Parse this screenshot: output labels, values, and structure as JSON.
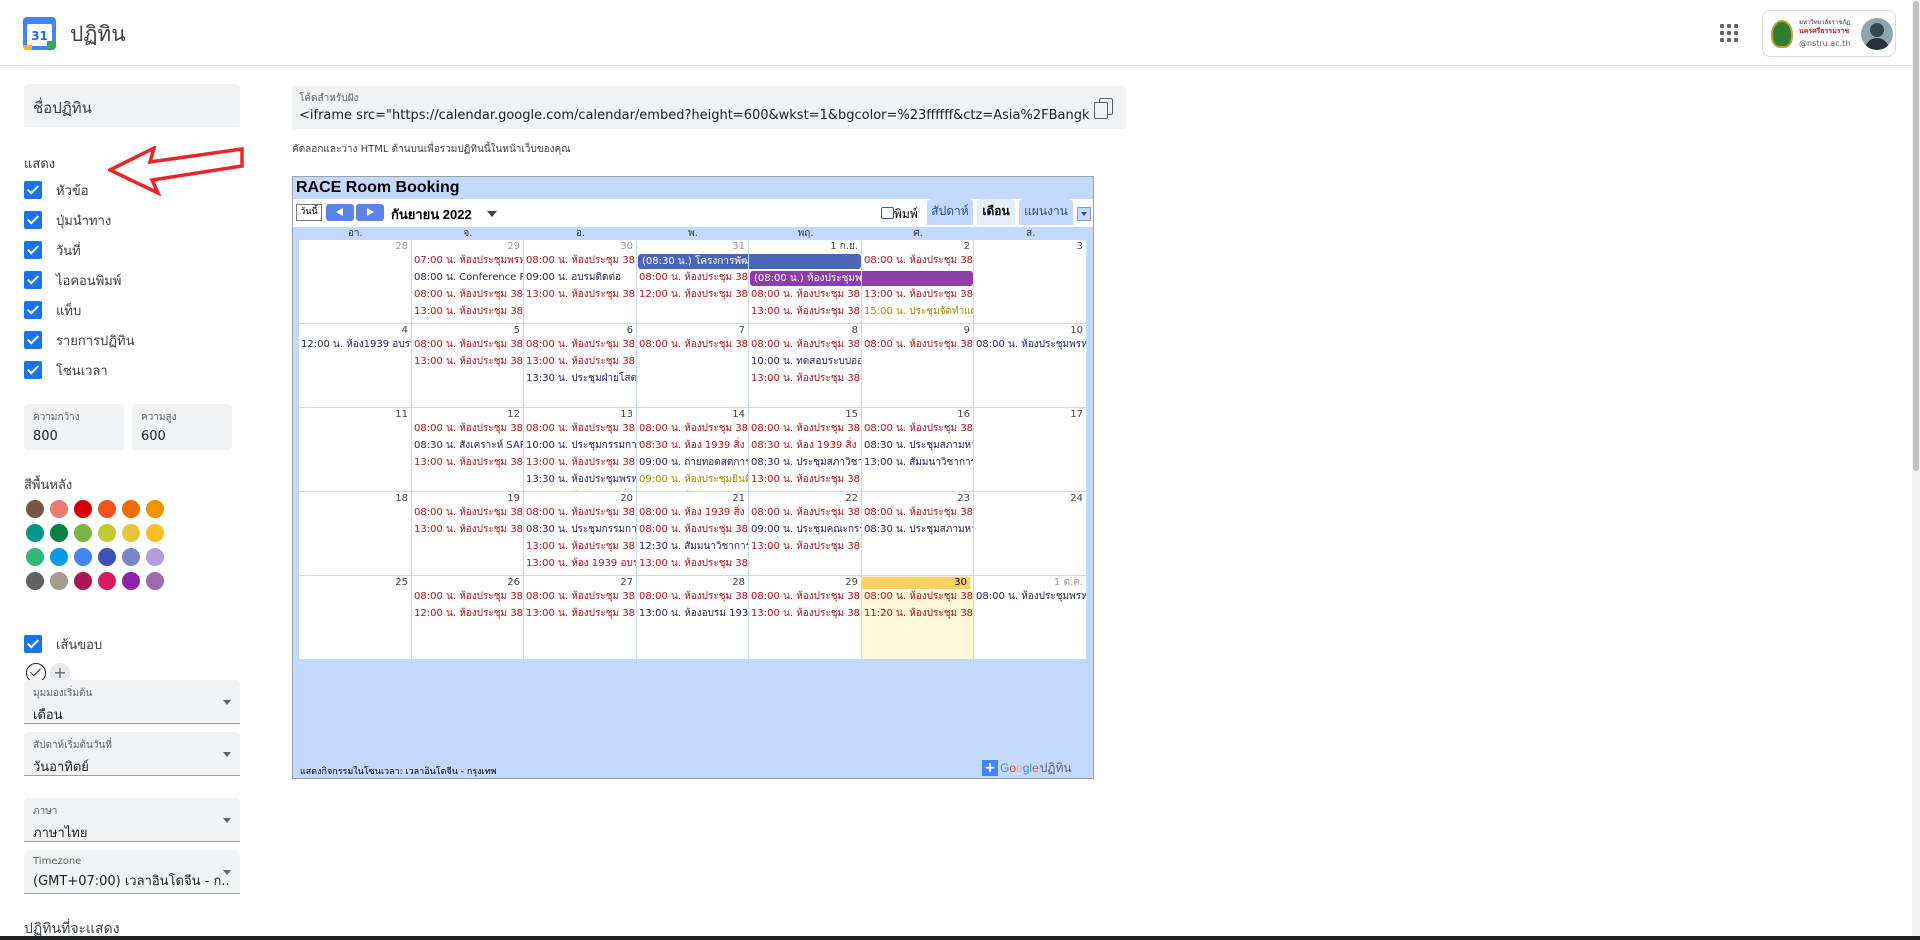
{
  "header": {
    "logo_number": "31",
    "app_title": "ปฏิทิน",
    "account_org_line1": "มหาวิทยาลัยราชภัฏ",
    "account_org_line2": "นครศรีธรรมราช",
    "account_domain": "@nstru.ac.th"
  },
  "sidebar": {
    "calendar_name": "ชื่อปฏิทิน",
    "show_label": "แสดง",
    "show_options": [
      {
        "label": "หัวข้อ",
        "checked": true
      },
      {
        "label": "ปุ่มนำทาง",
        "checked": true
      },
      {
        "label": "วันที่",
        "checked": true
      },
      {
        "label": "ไอคอนพิมพ์",
        "checked": true
      },
      {
        "label": "แท็บ",
        "checked": true
      },
      {
        "label": "รายการปฏิทิน",
        "checked": true
      },
      {
        "label": "โซนเวลา",
        "checked": true
      }
    ],
    "width_label": "ความกว้าง",
    "width_value": "800",
    "height_label": "ความสูง",
    "height_value": "600",
    "bg_label": "สีพื้นหลัง",
    "swatches": [
      "#795548",
      "#e67c73",
      "#d50000",
      "#f4511e",
      "#ef6c00",
      "#f09300",
      "#009688",
      "#0b8043",
      "#7cb342",
      "#c0ca33",
      "#e4c441",
      "#f6bf26",
      "#33b679",
      "#039be5",
      "#4285f4",
      "#3f51b5",
      "#7986cb",
      "#b39ddb",
      "#616161",
      "#a79b8e",
      "#ad1457",
      "#d81b60",
      "#8e24aa",
      "#9e69af"
    ],
    "border_label": "เส้นขอบ",
    "border_checked": true,
    "default_view_label": "มุมมองเริ่มต้น",
    "default_view_value": "เดือน",
    "week_start_label": "สัปดาห์เริ่มต้นวันที่",
    "week_start_value": "วันอาทิตย์",
    "language_label": "ภาษา",
    "language_value": "ภาษาไทย",
    "timezone_label": "Timezone",
    "timezone_value": "(GMT+07:00) เวลาอินโดจีน - ก...",
    "calendars_label": "ปฏิทินที่จะแสดง"
  },
  "embed": {
    "label": "โค้ดสำหรับฝัง",
    "code": "<iframe src=\"https://calendar.google.com/calendar/embed?height=600&wkst=1&bgcolor=%23ffffff&ctz=Asia%2FBangkok&src",
    "hint": "คัดลอกและวาง HTML ด้านบนเพื่อรวมปฏิทินนี้ในหน้าเว็บของคุณ"
  },
  "calendar": {
    "title": "RACE Room Booking",
    "today_label": "วันนี้",
    "month_label": "กันยายน 2022",
    "print_label": "พิมพ์",
    "tabs": [
      {
        "label": "สัปดาห์",
        "active": false
      },
      {
        "label": "เดือน",
        "active": true
      },
      {
        "label": "แผนงาน",
        "active": false
      }
    ],
    "dow": [
      "อา.",
      "จ.",
      "อ.",
      "พ.",
      "พฤ.",
      "ศ.",
      "ส."
    ],
    "timezone_note": "แสดงกิจกรรมในโซนเวลา: เวลาอินโดจีน - กรุงเทพ",
    "google_word": [
      "G",
      "o",
      "o",
      "g",
      "l",
      "e"
    ],
    "google_suffix": "ปฏิทิน",
    "colors": {
      "red": "#b31412",
      "navy": "#222266",
      "olive": "#a28a00",
      "allday_blue": "#4a66b8",
      "allday_purple": "#8e3ea8",
      "today_bg": "#fff7d7"
    },
    "weeks": [
      [
        {
          "day": "28",
          "other": true,
          "events": []
        },
        {
          "day": "29",
          "other": true,
          "events": [
            {
              "text": "07:00 น. ห้องประชุมพรหม",
              "color": "red"
            },
            {
              "text": "08:00 น. Conference Ro",
              "color": "navy"
            },
            {
              "text": "08:00 น. ห้องประชุม 38",
              "color": "red"
            },
            {
              "text": "13:00 น. ห้องประชุม 38",
              "color": "red"
            }
          ]
        },
        {
          "day": "30",
          "other": true,
          "events": [
            {
              "text": "08:00 น. ห้องประชุม 38",
              "color": "red"
            },
            {
              "text": "09:00 น. อบรมติดต่อ",
              "color": "navy"
            },
            {
              "text": "13:00 น. ห้องประชุม 38",
              "color": "red"
            }
          ]
        },
        {
          "day": "31",
          "other": true,
          "events": [
            {
              "text": "(08:30 น.) โครงการพัฒนาบุคลากรสายสนับสนุน",
              "color": "allday_blue",
              "allday": true
            },
            {
              "text": "08:00 น. ห้องประชุม 38",
              "color": "red"
            },
            {
              "text": "12:00 น. ห้องประชุม 38",
              "color": "red"
            }
          ]
        },
        {
          "day": "1 ก.ย.",
          "events": [
            {
              "text": "",
              "color": "allday_blue",
              "allday": true,
              "cont": true
            },
            {
              "text": "(08:00 น.) ห้องประชุมพรหมโยธี โครงการสร้าง",
              "color": "allday_purple",
              "allday": true
            },
            {
              "text": "08:00 น. ห้องประชุม 38",
              "color": "red"
            },
            {
              "text": "13:00 น. ห้องประชุม 38",
              "color": "red"
            }
          ]
        },
        {
          "day": "2",
          "events": [
            {
              "text": "08:00 น. ห้องประชุม 38",
              "color": "red"
            },
            {
              "text": "",
              "color": "allday_purple",
              "allday": true,
              "cont": true
            },
            {
              "text": "13:00 น. ห้องประชุม 38",
              "color": "red"
            },
            {
              "text": "15:00 น. ประชุมจัดทำแผน",
              "color": "olive"
            }
          ]
        },
        {
          "day": "3",
          "events": []
        }
      ],
      [
        {
          "day": "4",
          "events": [
            {
              "text": "12:00 น. ห้อง1939 อบรม",
              "color": "navy"
            }
          ]
        },
        {
          "day": "5",
          "events": [
            {
              "text": "08:00 น. ห้องประชุม 38",
              "color": "red"
            },
            {
              "text": "13:00 น. ห้องประชุม 38",
              "color": "red"
            }
          ]
        },
        {
          "day": "6",
          "events": [
            {
              "text": "08:00 น. ห้องประชุม 38",
              "color": "red"
            },
            {
              "text": "13:00 น. ห้องประชุม 38",
              "color": "red"
            },
            {
              "text": "13:30 น. ประชุมฝ่ายโสตฯ",
              "color": "navy"
            }
          ]
        },
        {
          "day": "7",
          "events": [
            {
              "text": "08:00 น. ห้องประชุม 38",
              "color": "red"
            }
          ]
        },
        {
          "day": "8",
          "events": [
            {
              "text": "08:00 น. ห้องประชุม 38",
              "color": "red"
            },
            {
              "text": "10:00 น. ทดสอบระบบออ",
              "color": "navy"
            },
            {
              "text": "13:00 น. ห้องประชุม 38",
              "color": "red"
            }
          ]
        },
        {
          "day": "9",
          "events": [
            {
              "text": "08:00 น. ห้องประชุม 38",
              "color": "red"
            }
          ]
        },
        {
          "day": "10",
          "events": [
            {
              "text": "08:00 น. ห้องประชุมพรหม",
              "color": "navy"
            }
          ]
        }
      ],
      [
        {
          "day": "11",
          "events": []
        },
        {
          "day": "12",
          "events": [
            {
              "text": "08:00 น. ห้องประชุม 38",
              "color": "red"
            },
            {
              "text": "08:30 น. สังเคราะห์ SAR",
              "color": "navy"
            },
            {
              "text": "13:00 น. ห้องประชุม 38",
              "color": "red"
            }
          ]
        },
        {
          "day": "13",
          "events": [
            {
              "text": "08:00 น. ห้องประชุม 38",
              "color": "red"
            },
            {
              "text": "10:00 น. ประชุมกรรมการ",
              "color": "navy"
            },
            {
              "text": "13:00 น. ห้องประชุม 38",
              "color": "red"
            },
            {
              "text": "13:30 น. ห้องประชุมพรหม",
              "color": "navy"
            },
            {
              "text": "14:00 น. ห้อง 1939 สิ่ง",
              "color": "red"
            }
          ]
        },
        {
          "day": "14",
          "events": [
            {
              "text": "08:00 น. ห้องประชุม 38",
              "color": "red"
            },
            {
              "text": "08:30 น. ห้อง 1939 สิ่ง",
              "color": "red"
            },
            {
              "text": "09:00 น. ถ่ายทอดสดการ",
              "color": "navy"
            },
            {
              "text": "09:00 น. ห้องประชุมยินดี",
              "color": "olive"
            },
            {
              "text": "13:00 น. ห้องประชุม 38",
              "color": "red"
            }
          ]
        },
        {
          "day": "15",
          "events": [
            {
              "text": "08:00 น. ห้องประชุม 38",
              "color": "red"
            },
            {
              "text": "08:30 น. ห้อง 1939 สิ่ง",
              "color": "red"
            },
            {
              "text": "08:30 น. ประชุมสภาวิชา",
              "color": "navy"
            },
            {
              "text": "13:00 น. ห้องประชุม 38",
              "color": "red"
            }
          ]
        },
        {
          "day": "16",
          "events": [
            {
              "text": "08:00 น. ห้องประชุม 38",
              "color": "red"
            },
            {
              "text": "08:30 น. ประชุมสภามหา",
              "color": "navy"
            },
            {
              "text": "13:00 น. สัมมนาวิชาการ",
              "color": "navy"
            }
          ]
        },
        {
          "day": "17",
          "events": []
        }
      ],
      [
        {
          "day": "18",
          "events": []
        },
        {
          "day": "19",
          "events": [
            {
              "text": "08:00 น. ห้องประชุม 38",
              "color": "red"
            },
            {
              "text": "13:00 น. ห้องประชุม 38",
              "color": "red"
            }
          ]
        },
        {
          "day": "20",
          "events": [
            {
              "text": "08:00 น. ห้องประชุม 38",
              "color": "red"
            },
            {
              "text": "08:30 น. ประชุมกรรมการ",
              "color": "navy"
            },
            {
              "text": "13:00 น. ห้องประชุม 38",
              "color": "red"
            },
            {
              "text": "13:00 น. ห้อง 1939 อบรม",
              "color": "red"
            }
          ]
        },
        {
          "day": "21",
          "events": [
            {
              "text": "08:00 น. ห้อง 1939 สิ่ง",
              "color": "red"
            },
            {
              "text": "08:00 น. ห้องประชุม 38",
              "color": "red"
            },
            {
              "text": "12:30 น. สัมมนาวิชาการ",
              "color": "navy"
            },
            {
              "text": "13:00 น. ห้องประชุม 38",
              "color": "red"
            }
          ]
        },
        {
          "day": "22",
          "events": [
            {
              "text": "08:00 น. ห้องประชุม 38",
              "color": "red"
            },
            {
              "text": "09:00 น. ประชุมคณะกรรม",
              "color": "navy"
            },
            {
              "text": "13:00 น. ห้องประชุม 38",
              "color": "red"
            }
          ]
        },
        {
          "day": "23",
          "events": [
            {
              "text": "08:00 น. ห้องประชุม 38",
              "color": "red"
            },
            {
              "text": "08:30 น. ประชุมสภามหา",
              "color": "navy"
            }
          ]
        },
        {
          "day": "24",
          "events": []
        }
      ],
      [
        {
          "day": "25",
          "events": []
        },
        {
          "day": "26",
          "events": [
            {
              "text": "08:00 น. ห้องประชุม 38",
              "color": "red"
            },
            {
              "text": "12:00 น. ห้องประชุม 38",
              "color": "red"
            }
          ]
        },
        {
          "day": "27",
          "events": [
            {
              "text": "08:00 น. ห้องประชุม 38",
              "color": "red"
            },
            {
              "text": "13:00 น. ห้องประชุม 38",
              "color": "red"
            }
          ]
        },
        {
          "day": "28",
          "events": [
            {
              "text": "08:00 น. ห้องประชุม 38",
              "color": "red"
            },
            {
              "text": "13:00 น. ห้องอบรม 1939",
              "color": "navy"
            }
          ]
        },
        {
          "day": "29",
          "events": [
            {
              "text": "08:00 น. ห้องประชุม 38",
              "color": "red"
            },
            {
              "text": "13:00 น. ห้องประชุม 38",
              "color": "red"
            }
          ]
        },
        {
          "day": "30",
          "today": true,
          "events": [
            {
              "text": "08:00 น. ห้องประชุม 38",
              "color": "red"
            },
            {
              "text": "11:20 น. ห้องประชุม 38",
              "color": "red"
            }
          ]
        },
        {
          "day": "1 ต.ค.",
          "other": true,
          "events": [
            {
              "text": "08:00 น. ห้องประชุมพรหม",
              "color": "navy"
            }
          ]
        }
      ]
    ]
  }
}
